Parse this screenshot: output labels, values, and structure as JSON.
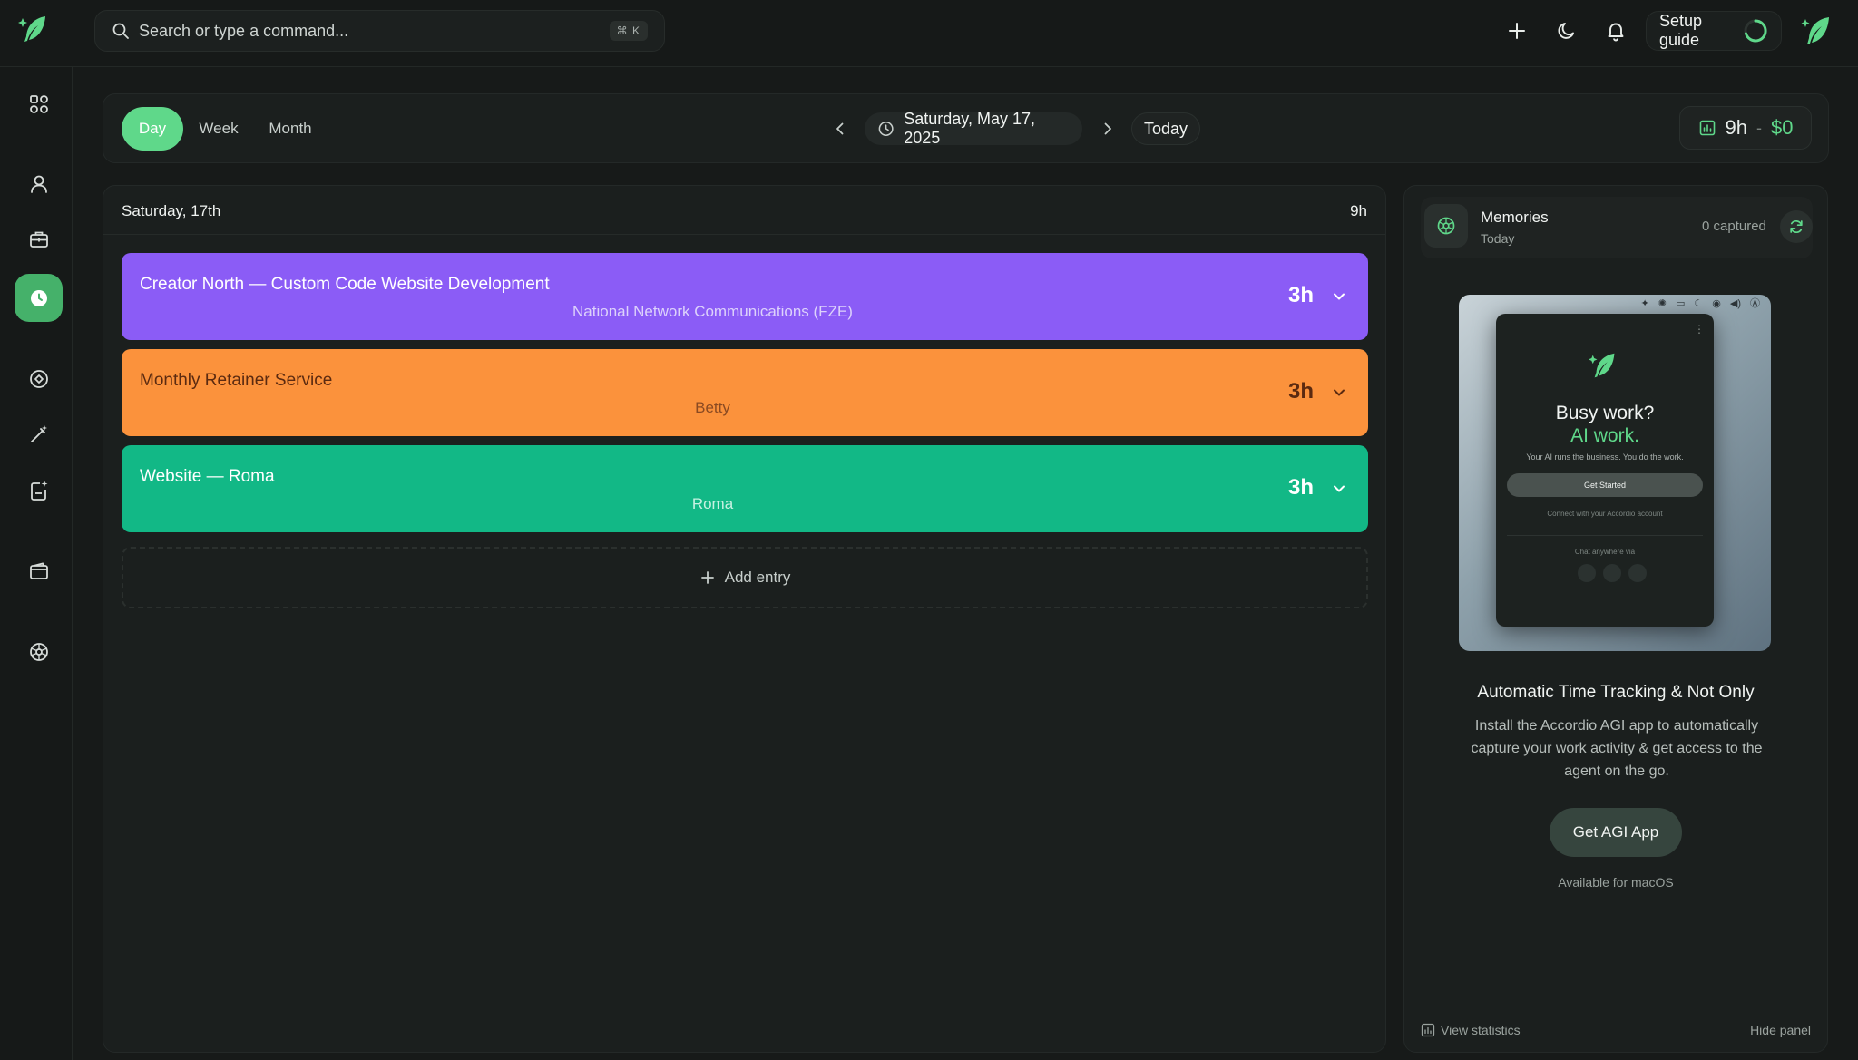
{
  "colors": {
    "accent": "#5fd88a",
    "entry_purple": "#8b5cf6",
    "entry_orange": "#fb923c",
    "entry_green": "#12b886"
  },
  "search": {
    "placeholder": "Search or type a command...",
    "shortcut": "⌘ K"
  },
  "topbar": {
    "icons": [
      "plus-icon",
      "moon-icon",
      "bell-icon"
    ],
    "setup_label": "Setup guide"
  },
  "sidebar": {
    "items": [
      {
        "icon": "apps-grid-icon"
      },
      {
        "icon": "user-icon"
      },
      {
        "icon": "briefcase-icon"
      },
      {
        "icon": "clock-icon",
        "active": true
      },
      {
        "icon": "target-icon"
      },
      {
        "icon": "magic-wand-icon"
      },
      {
        "icon": "document-sparkle-icon"
      },
      {
        "icon": "wallet-icon"
      },
      {
        "icon": "ai-agent-icon"
      }
    ]
  },
  "toolbar": {
    "views": [
      "Day",
      "Week",
      "Month"
    ],
    "active_view": "Day",
    "date": "Saturday, May 17, 2025",
    "today_label": "Today",
    "total_hours": "9h",
    "total_separator": "-",
    "total_money": "$0"
  },
  "day": {
    "label": "Saturday, 17th",
    "hours": "9h",
    "entries": [
      {
        "title": "Creator North — Custom Code Website Development",
        "client": "National Network Communications (FZE)",
        "duration": "3h"
      },
      {
        "title": "Monthly Retainer Service",
        "client": "Betty",
        "duration": "3h"
      },
      {
        "title": "Website — Roma",
        "client": "Roma",
        "duration": "3h"
      }
    ],
    "add_label": "Add entry"
  },
  "memories": {
    "title": "Memories",
    "subtitle": "Today",
    "count": "0 captured"
  },
  "promo": {
    "window": {
      "headline": "Busy work?",
      "headline_accent": "AI work.",
      "tagline": "Your AI runs the business. You do the work.",
      "button": "Get Started",
      "link": "Connect with your Accordio account",
      "chat": "Chat anywhere via"
    },
    "title": "Automatic Time Tracking & Not Only",
    "text": "Install the Accordio AGI app to automatically capture your work activity & get access to the agent on the go.",
    "button": "Get AGI App",
    "note": "Available for macOS"
  },
  "footer": {
    "stats_label": "View statistics",
    "hide_label": "Hide panel"
  }
}
